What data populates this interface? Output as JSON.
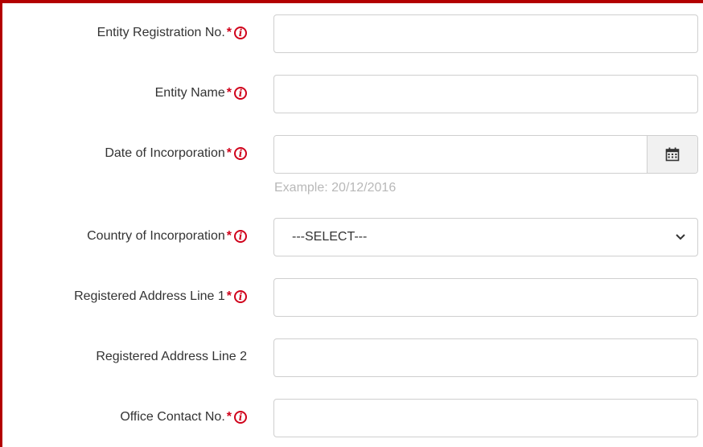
{
  "form": {
    "fields": [
      {
        "label": "Entity Registration No.",
        "required": true,
        "info": true,
        "value": ""
      },
      {
        "label": "Entity Name",
        "required": true,
        "info": true,
        "value": ""
      },
      {
        "label": "Date of Incorporation",
        "required": true,
        "info": true,
        "value": "",
        "hint": "Example: 20/12/2016",
        "icon": "calendar-icon"
      },
      {
        "label": "Country of Incorporation",
        "required": true,
        "info": true,
        "selected": "---SELECT---",
        "icon": "chevron-down-icon"
      },
      {
        "label": "Registered Address Line 1",
        "required": true,
        "info": true,
        "value": ""
      },
      {
        "label": "Registered Address Line 2",
        "required": false,
        "info": false,
        "value": ""
      },
      {
        "label": "Office Contact No.",
        "required": true,
        "info": true,
        "value": ""
      }
    ],
    "required_mark": "*",
    "info_glyph": "i"
  },
  "colors": {
    "required": "#d0021b",
    "frame": "#b30000",
    "border": "#cfcfcf",
    "hint": "#b8b8b8"
  }
}
